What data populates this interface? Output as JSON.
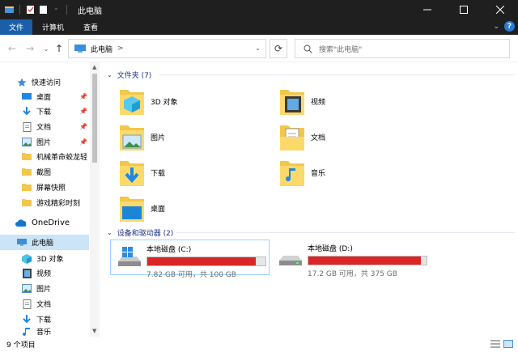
{
  "window": {
    "title": "此电脑",
    "colors": {
      "titlebar": "#1f1f1f",
      "file_tab": "#1a5fa8",
      "drive_bar": "#da2626",
      "selection": "#cce4f7"
    }
  },
  "ribbon": {
    "tabs": [
      "文件",
      "计算机",
      "查看"
    ],
    "help": "?"
  },
  "address": {
    "crumb": "此电脑",
    "chevron": ">"
  },
  "search": {
    "placeholder": "搜索\"此电脑\""
  },
  "sidebar": {
    "items": [
      {
        "label": "快速访问",
        "icon": "star-icon",
        "pinned": false
      },
      {
        "label": "桌面",
        "icon": "desktop-icon",
        "pinned": true
      },
      {
        "label": "下载",
        "icon": "download-icon",
        "pinned": true
      },
      {
        "label": "文档",
        "icon": "document-icon",
        "pinned": true
      },
      {
        "label": "图片",
        "icon": "picture-icon",
        "pinned": true
      },
      {
        "label": "机械革命蛟龙轻",
        "icon": "folder-icon",
        "pinned": false
      },
      {
        "label": "截图",
        "icon": "folder-icon",
        "pinned": false
      },
      {
        "label": "屏幕快照",
        "icon": "folder-icon",
        "pinned": false
      },
      {
        "label": "游戏精彩时刻",
        "icon": "folder-icon",
        "pinned": false
      },
      {
        "label": "OneDrive",
        "icon": "cloud-icon",
        "pinned": false
      },
      {
        "label": "此电脑",
        "icon": "computer-icon",
        "pinned": false
      },
      {
        "label": "3D 对象",
        "icon": "cube-icon",
        "pinned": false
      },
      {
        "label": "视频",
        "icon": "video-icon",
        "pinned": false
      },
      {
        "label": "图片",
        "icon": "picture-icon",
        "pinned": false
      },
      {
        "label": "文档",
        "icon": "document-icon",
        "pinned": false
      },
      {
        "label": "下载",
        "icon": "download-icon",
        "pinned": false
      },
      {
        "label": "音乐",
        "icon": "music-icon",
        "pinned": false
      }
    ]
  },
  "folders_group": {
    "label": "文件夹 (7)"
  },
  "folders": [
    {
      "label": "3D 对象",
      "icon": "cube-icon"
    },
    {
      "label": "视频",
      "icon": "video-icon"
    },
    {
      "label": "图片",
      "icon": "picture-icon"
    },
    {
      "label": "文档",
      "icon": "document-icon"
    },
    {
      "label": "下载",
      "icon": "download-icon"
    },
    {
      "label": "音乐",
      "icon": "music-icon"
    },
    {
      "label": "桌面",
      "icon": "desktop-icon"
    }
  ],
  "drives_group": {
    "label": "设备和驱动器 (2)"
  },
  "drives": [
    {
      "name": "本地磁盘 (C:)",
      "free_text": "7.82 GB 可用，共 100 GB",
      "used_fraction": 0.92
    },
    {
      "name": "本地磁盘 (D:)",
      "free_text": "17.2 GB 可用，共 375 GB",
      "used_fraction": 0.95
    }
  ],
  "status": {
    "count": "9 个项目"
  }
}
